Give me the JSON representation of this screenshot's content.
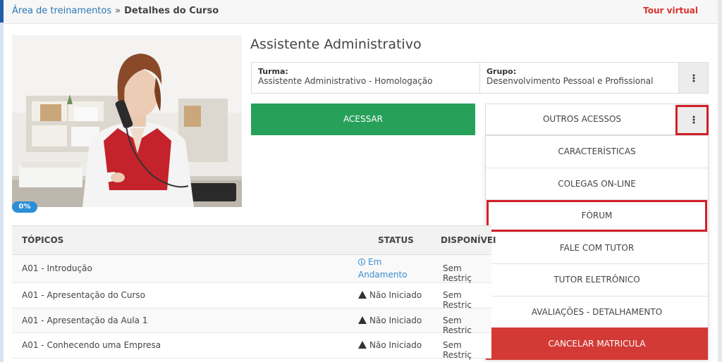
{
  "breadcrumb": {
    "parent": "Área de treinamentos",
    "separator": "»",
    "current": "Detalhes do Curso"
  },
  "header": {
    "tour_label": "Tour virtual"
  },
  "course": {
    "title": "Assistente Administrativo",
    "progress": "0%",
    "turma_label": "Turma:",
    "turma_value": "Assistente Administrativo - Homologação",
    "grupo_label": "Grupo:",
    "grupo_value": "Desenvolvimento Pessoal e Profissional"
  },
  "actions": {
    "acessar": "ACESSAR",
    "outros": "OUTROS ACESSOS"
  },
  "dropdown": {
    "items": [
      "CARACTERÍSTICAS",
      "COLEGAS ON-LINE",
      "FÓRUM",
      "FALE COM TUTOR",
      "TUTOR ELETRÔNICO",
      "AVALIAÇÕES - DETALHAMENTO",
      "CANCELAR MATRICULA"
    ]
  },
  "table": {
    "headers": {
      "topics": "TÓPICOS",
      "status": "STATUS",
      "disp": "DISPONÍVEI"
    },
    "rows": [
      {
        "topic": "A01 - Introdução",
        "status_line1": "Em",
        "status_line2": "Andamento",
        "disp": "Sem Restriç"
      },
      {
        "topic": "A01 - Apresentação do Curso",
        "status": "Não Iniciado",
        "disp": "Sem Restriç"
      },
      {
        "topic": "A01 - Apresentação da Aula 1",
        "status": "Não Iniciado",
        "disp": "Sem Restriç"
      },
      {
        "topic": "A01 - Conhecendo uma Empresa",
        "status": "Não Iniciado",
        "disp": "Sem Restriç"
      }
    ]
  },
  "colors": {
    "accent_green": "#27a05a",
    "danger_red": "#d33a36",
    "highlight_red": "#d11f28",
    "link_blue": "#2a77b8"
  },
  "icons": [
    "kebab-menu-icon",
    "clock-icon",
    "warning-icon"
  ]
}
